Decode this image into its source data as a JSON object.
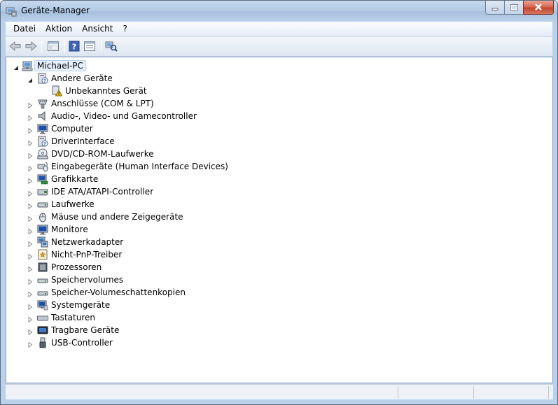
{
  "window": {
    "title": "Geräte-Manager"
  },
  "menu": [
    "Datei",
    "Aktion",
    "Ansicht",
    "?"
  ],
  "toolbar": [
    "back-icon",
    "forward-icon",
    "console-tree-icon",
    "help-icon",
    "properties-icon",
    "scan-hardware-icon"
  ],
  "tree": {
    "root": {
      "label": "Michael-PC",
      "icon": "computer-icon",
      "expanded": true
    },
    "categories": [
      {
        "label": "Andere Geräte",
        "icon": "unknown-device-icon",
        "expanded": true,
        "children": [
          {
            "label": "Unbekanntes Gerät",
            "icon": "warning-device-icon"
          }
        ]
      },
      {
        "label": "Anschlüsse (COM & LPT)",
        "icon": "port-icon"
      },
      {
        "label": "Audio-, Video- und Gamecontroller",
        "icon": "speaker-icon"
      },
      {
        "label": "Computer",
        "icon": "monitor-icon"
      },
      {
        "label": "DriverInterface",
        "icon": "unknown-device-icon"
      },
      {
        "label": "DVD/CD-ROM-Laufwerke",
        "icon": "disc-drive-icon"
      },
      {
        "label": "Eingabegeräte (Human Interface Devices)",
        "icon": "hid-icon"
      },
      {
        "label": "Grafikkarte",
        "icon": "display-adapter-icon"
      },
      {
        "label": "IDE ATA/ATAPI-Controller",
        "icon": "ide-controller-icon"
      },
      {
        "label": "Laufwerke",
        "icon": "disk-drive-icon"
      },
      {
        "label": "Mäuse und andere Zeigegeräte",
        "icon": "mouse-icon"
      },
      {
        "label": "Monitore",
        "icon": "monitor-icon"
      },
      {
        "label": "Netzwerkadapter",
        "icon": "network-adapter-icon"
      },
      {
        "label": "Nicht-PnP-Treiber",
        "icon": "non-pnp-driver-icon"
      },
      {
        "label": "Prozessoren",
        "icon": "processor-icon"
      },
      {
        "label": "Speichervolumes",
        "icon": "storage-volume-icon"
      },
      {
        "label": "Speicher-Volumeschattenkopien",
        "icon": "storage-volume-icon"
      },
      {
        "label": "Systemgeräte",
        "icon": "system-device-icon"
      },
      {
        "label": "Tastaturen",
        "icon": "keyboard-icon"
      },
      {
        "label": "Tragbare Geräte",
        "icon": "portable-device-icon"
      },
      {
        "label": "USB-Controller",
        "icon": "usb-icon"
      }
    ]
  },
  "colors": {
    "frame": "#b9d1ea",
    "selection": "#e5f0fb",
    "close": "#c3452f"
  }
}
